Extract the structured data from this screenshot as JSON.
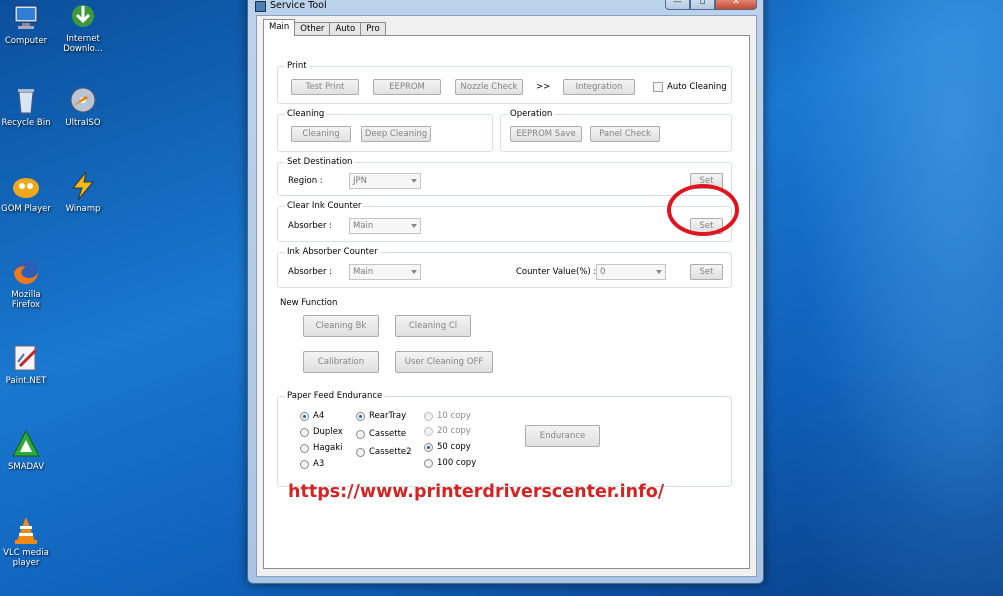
{
  "desktop": {
    "icons": [
      {
        "label": "Computer",
        "icon": "computer-icon"
      },
      {
        "label": "Internet\nDownlo...",
        "icon": "download-manager-icon"
      },
      {
        "label": "Recycle Bin",
        "icon": "recycle-bin-icon"
      },
      {
        "label": "UltraISO",
        "icon": "disc-icon"
      },
      {
        "label": "GOM Player",
        "icon": "gom-player-icon"
      },
      {
        "label": "Winamp",
        "icon": "winamp-icon"
      },
      {
        "label": "Mozilla\nFirefox",
        "icon": "firefox-icon"
      },
      {
        "label": "Paint.NET",
        "icon": "paint-icon"
      },
      {
        "label": "SMADAV",
        "icon": "smadav-icon"
      },
      {
        "label": "VLC media\nplayer",
        "icon": "vlc-icon"
      }
    ]
  },
  "window": {
    "title": "Service Tool",
    "min": "—",
    "max": "▫",
    "close": "✕"
  },
  "tabs": [
    {
      "label": "Main",
      "active": true
    },
    {
      "label": "Other",
      "active": false
    },
    {
      "label": "Auto",
      "active": false
    },
    {
      "label": "Pro",
      "active": false
    }
  ],
  "print": {
    "label": "Print",
    "test_print": "Test Print",
    "eeprom": "EEPROM",
    "nozzle_check": "Nozzle Check",
    "arrow": ">>",
    "integration": "Integration",
    "auto_cleaning": "Auto Cleaning"
  },
  "cleaning": {
    "label": "Cleaning",
    "cleaning": "Cleaning",
    "deep_cleaning": "Deep Cleaning"
  },
  "operation": {
    "label": "Operation",
    "eeprom_save": "EEPROM Save",
    "panel_check": "Panel Check"
  },
  "set_destination": {
    "label": "Set Destination",
    "region_label": "Region :",
    "region_value": "JPN",
    "set": "Set"
  },
  "clear_ink_counter": {
    "label": "Clear Ink Counter",
    "absorber_label": "Absorber :",
    "absorber_value": "Main",
    "set": "Set"
  },
  "ink_absorber_counter": {
    "label": "Ink Absorber Counter",
    "absorber_label": "Absorber :",
    "absorber_value": "Main",
    "counter_label": "Counter Value(%) :",
    "counter_value": "0",
    "set": "Set"
  },
  "new_function": {
    "label": "New Function",
    "cleaning_bk": "Cleaning Bk",
    "cleaning_cl": "Cleaning Cl",
    "calibration": "Calibration",
    "user_cleaning_off": "User Cleaning OFF"
  },
  "paper_feed": {
    "label": "Paper Feed Endurance",
    "sizes": [
      {
        "label": "A4",
        "selected": true
      },
      {
        "label": "Duplex",
        "selected": false
      },
      {
        "label": "Hagaki",
        "selected": false
      },
      {
        "label": "A3",
        "selected": false
      }
    ],
    "trays": [
      {
        "label": "RearTray",
        "selected": true
      },
      {
        "label": "Cassette",
        "selected": false
      },
      {
        "label": "Cassette2",
        "selected": false
      }
    ],
    "copies": [
      {
        "label": "10 copy",
        "selected": false
      },
      {
        "label": "20 copy",
        "selected": false
      },
      {
        "label": "50 copy",
        "selected": true
      },
      {
        "label": "100 copy",
        "selected": false
      }
    ],
    "endurance": "Endurance"
  },
  "watermark_url": "https://www.printerdriverscenter.info/",
  "colors": {
    "highlight": "#e0141e",
    "url": "#d32424"
  }
}
